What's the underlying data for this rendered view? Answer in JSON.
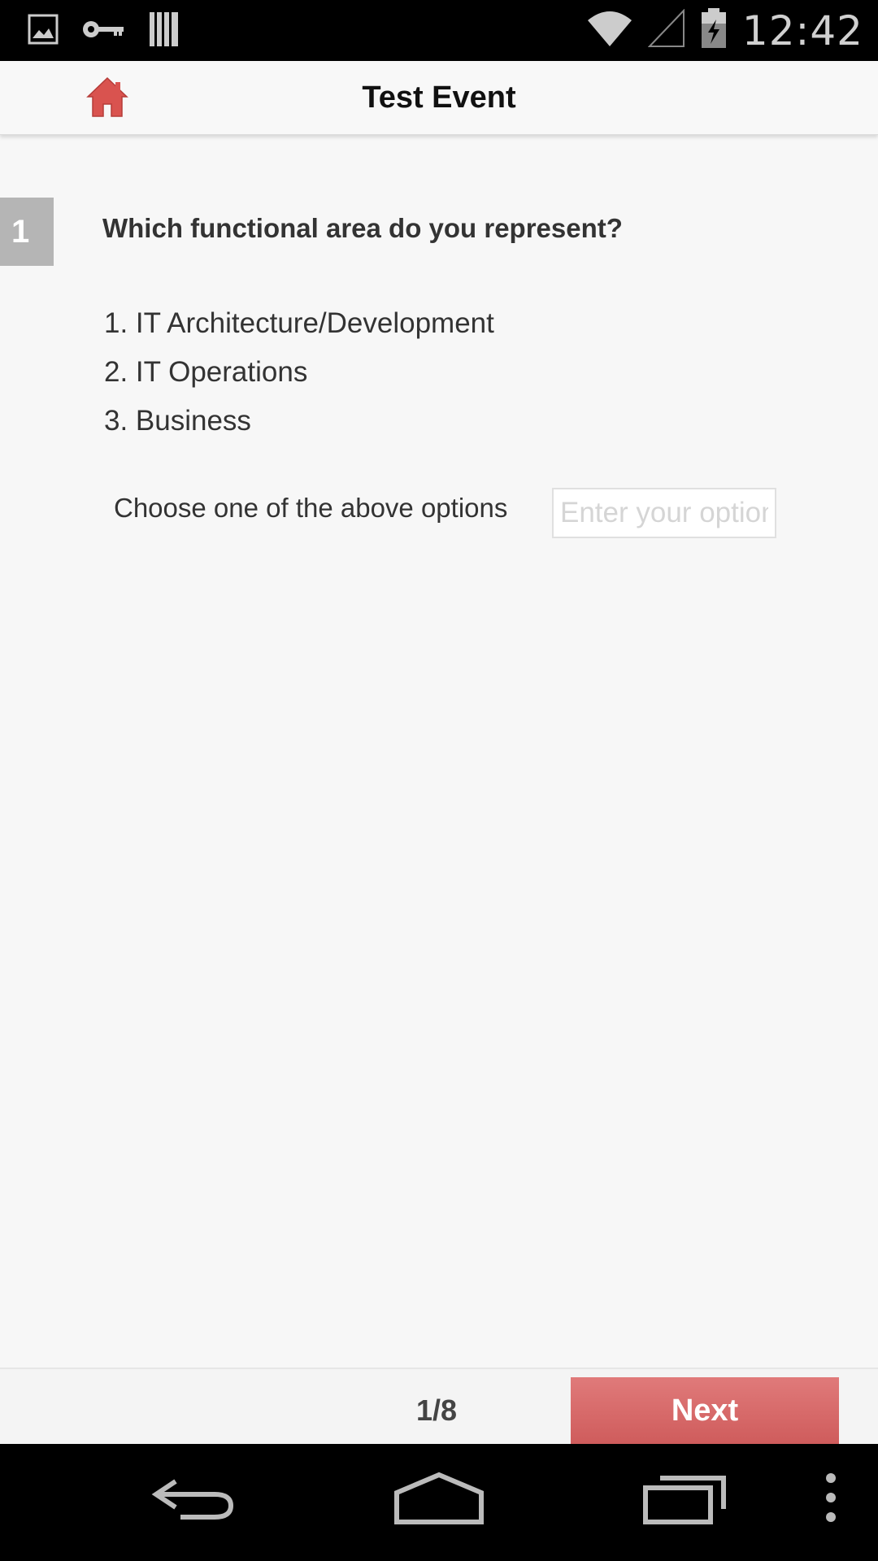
{
  "status_bar": {
    "time": "12:42",
    "left_icons": [
      "image-icon",
      "key-icon",
      "storage-icon"
    ],
    "right_icons": [
      "wifi-icon",
      "signal-icon",
      "battery-charging-icon"
    ]
  },
  "header": {
    "title": "Test Event",
    "home_icon": "home-icon",
    "accent_color": "#d9534f"
  },
  "question": {
    "number": "1",
    "text": "Which functional area do you represent?",
    "options": [
      "1. IT Architecture/Development",
      "2. IT Operations",
      "3. Business"
    ],
    "choose_label": "Choose one of the above options",
    "input_placeholder": "Enter your option",
    "input_value": ""
  },
  "footer": {
    "page_indicator": "1/8",
    "next_label": "Next",
    "next_color": "#d9605f"
  },
  "nav_bar": {
    "buttons": [
      "back-icon",
      "home-nav-icon",
      "recents-icon",
      "overflow-menu-icon"
    ]
  }
}
